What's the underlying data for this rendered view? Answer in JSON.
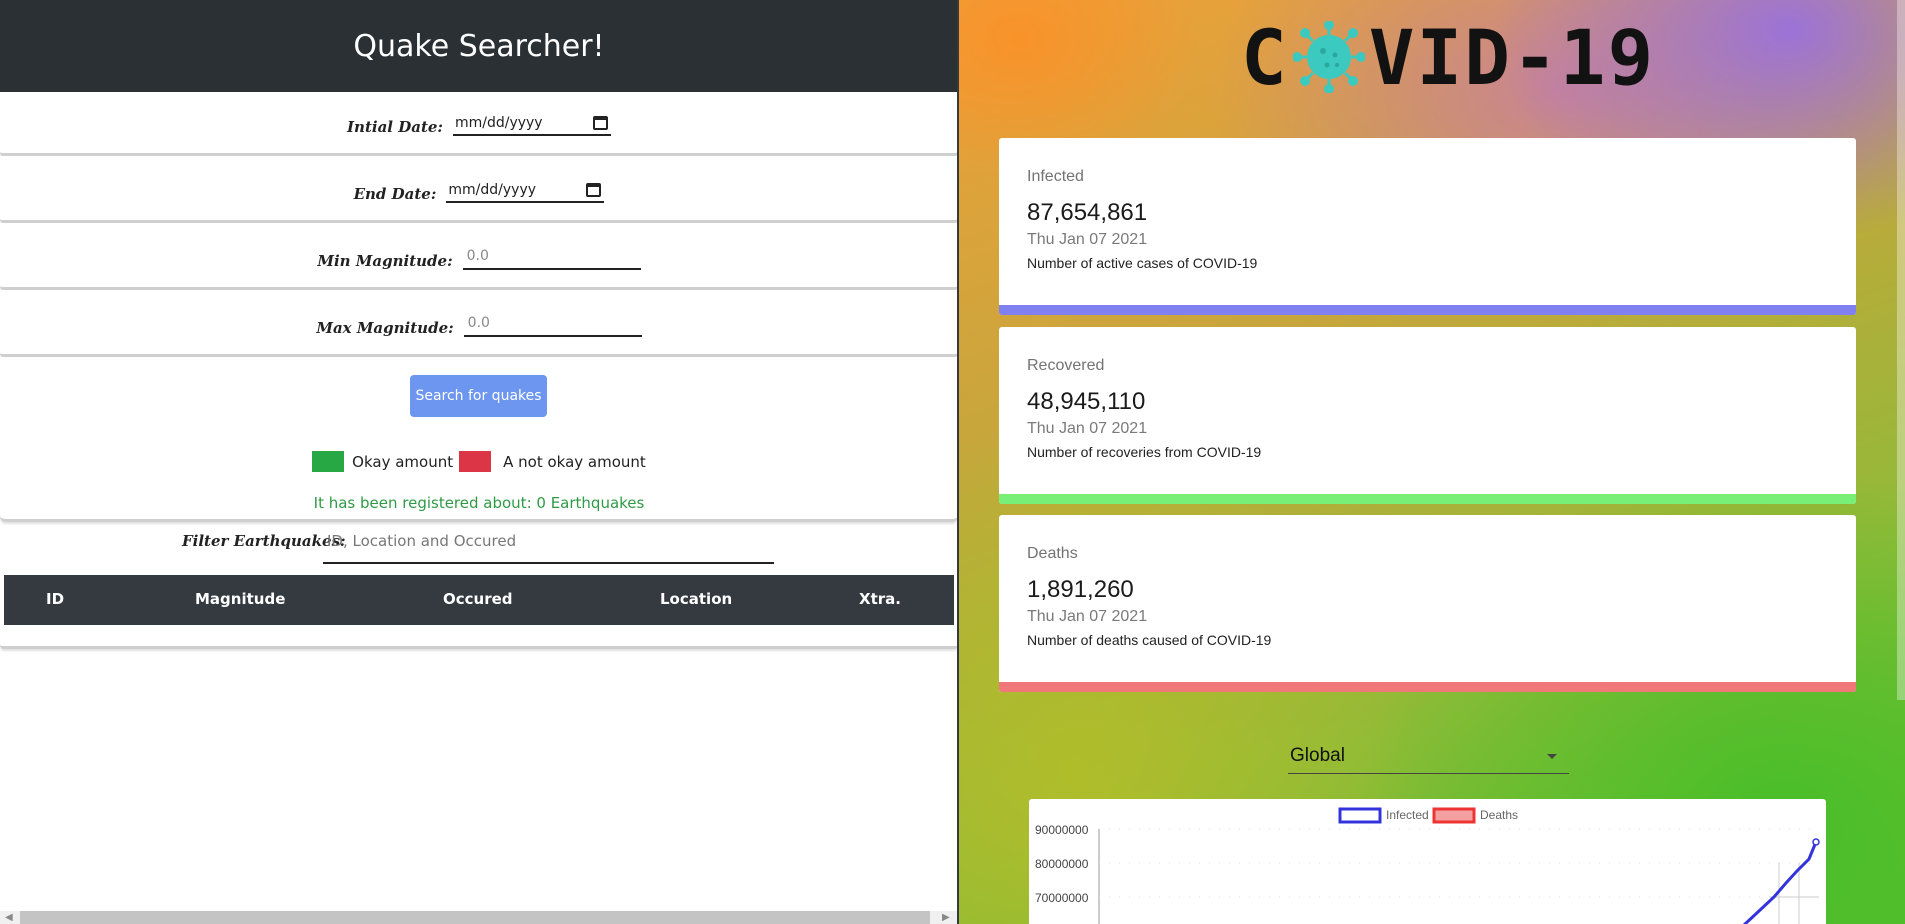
{
  "quake": {
    "title": "Quake Searcher!",
    "fields": {
      "initial_label": "Intial Date:",
      "initial_value": "mm/dd/yyyy",
      "end_label": "End Date:",
      "end_value": "mm/dd/yyyy",
      "min_label": "Min Magnitude:",
      "min_placeholder": "0.0",
      "max_label": "Max Magnitude:",
      "max_placeholder": "0.0"
    },
    "search_button": "Search for quakes",
    "legend": {
      "okay": "Okay amount",
      "not_okay": "A not okay amount",
      "okay_color": "#28a745",
      "not_okay_color": "#dc3545"
    },
    "count_text": "It has been registered about: 0 Earthquakes",
    "filter": {
      "label": "Filter Earthquakes:",
      "placeholder": "ID, Location and Occured"
    },
    "table_headers": [
      "ID",
      "Magnitude",
      "Occured",
      "Location",
      "Xtra."
    ]
  },
  "covid": {
    "logo_left": "C",
    "logo_right": "VID-19",
    "cards": [
      {
        "title": "Infected",
        "value": "87,654,861",
        "date": "Thu Jan 07 2021",
        "desc": "Number of active cases of COVID-19",
        "color": "#8080f0"
      },
      {
        "title": "Recovered",
        "value": "48,945,110",
        "date": "Thu Jan 07 2021",
        "desc": "Number of recoveries from COVID-19",
        "color": "#78f078"
      },
      {
        "title": "Deaths",
        "value": "1,891,260",
        "date": "Thu Jan 07 2021",
        "desc": "Number of deaths caused of COVID-19",
        "color": "#f07878"
      }
    ],
    "region": "Global",
    "chart": {
      "legend": [
        "Infected",
        "Deaths"
      ],
      "legend_colors": [
        "#3333dd",
        "#ee3333"
      ],
      "y_ticks": [
        "90000000",
        "80000000",
        "70000000"
      ]
    }
  }
}
